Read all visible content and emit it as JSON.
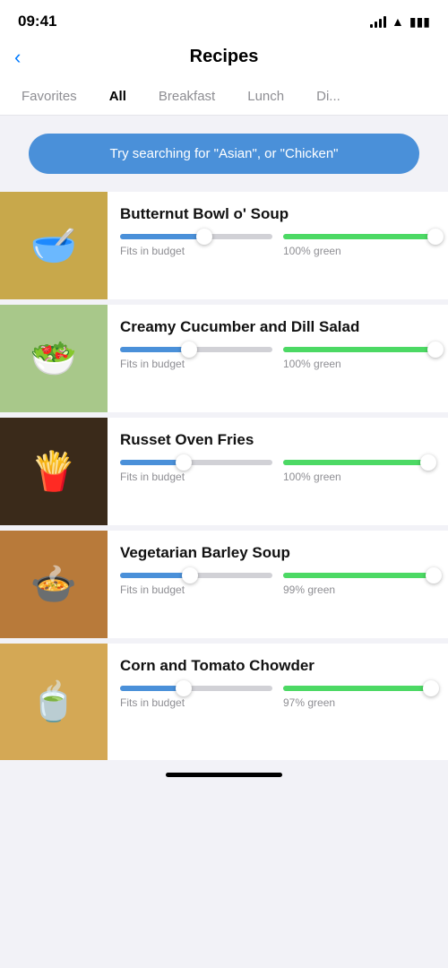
{
  "statusBar": {
    "time": "09:41"
  },
  "navBar": {
    "backIcon": "‹",
    "title": "Recipes"
  },
  "tabs": [
    {
      "id": "favorites",
      "label": "Favorites",
      "active": false
    },
    {
      "id": "all",
      "label": "All",
      "active": true
    },
    {
      "id": "breakfast",
      "label": "Breakfast",
      "active": false
    },
    {
      "id": "lunch",
      "label": "Lunch",
      "active": false
    },
    {
      "id": "dinner",
      "label": "Di...",
      "active": false
    }
  ],
  "searchBanner": {
    "text": "Try searching for \"Asian\", or \"Chicken\""
  },
  "recipes": [
    {
      "id": 1,
      "title": "Butternut Bowl o' Soup",
      "emoji": "🥣",
      "bgColor": "#c8a84b",
      "budgetLabel": "Fits in budget",
      "greenLabel": "100% green",
      "bluePercent": 55,
      "greenPercent": 100
    },
    {
      "id": 2,
      "title": "Creamy Cucumber and Dill Salad",
      "emoji": "🥗",
      "bgColor": "#a8c88a",
      "budgetLabel": "Fits in budget",
      "greenLabel": "100% green",
      "bluePercent": 45,
      "greenPercent": 100
    },
    {
      "id": 3,
      "title": "Russet Oven Fries",
      "emoji": "🍟",
      "bgColor": "#3a2a1a",
      "budgetLabel": "Fits in budget",
      "greenLabel": "100% green",
      "bluePercent": 42,
      "greenPercent": 95
    },
    {
      "id": 4,
      "title": "Vegetarian Barley Soup",
      "emoji": "🍲",
      "bgColor": "#b87a3a",
      "budgetLabel": "Fits in budget",
      "greenLabel": "99% green",
      "bluePercent": 46,
      "greenPercent": 99
    },
    {
      "id": 5,
      "title": "Corn and Tomato Chowder",
      "emoji": "🍵",
      "bgColor": "#d4a855",
      "budgetLabel": "Fits in budget",
      "greenLabel": "97% green",
      "bluePercent": 42,
      "greenPercent": 97
    }
  ]
}
